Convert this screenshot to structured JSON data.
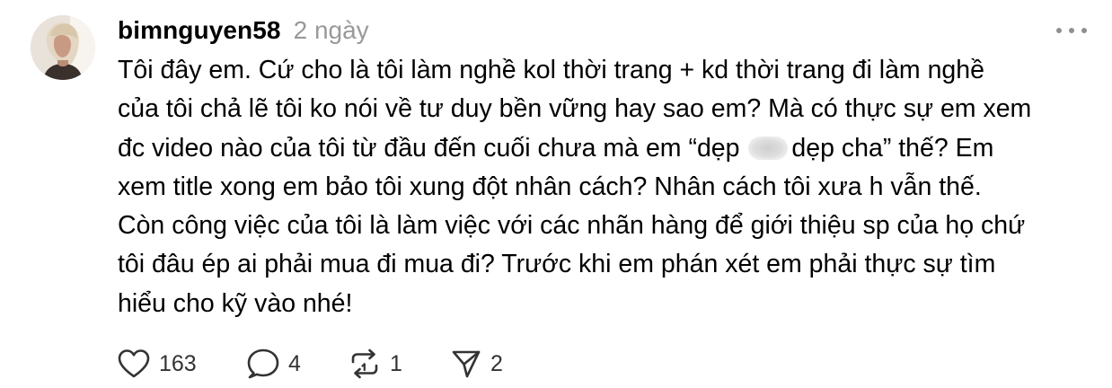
{
  "post": {
    "username": "bimnguyen58",
    "timestamp": "2 ngày",
    "avatar_icon": "user-avatar-photo",
    "more_icon": "more-horizontal-icon",
    "body_lines": [
      "Tôi đây em. Cứ cho là tôi làm nghề kol thời trang + kd thời trang đi làm nghề",
      "của tôi chả lẽ tôi ko nói về tư duy bền vững hay sao em? Mà có thực sự em xem",
      {
        "before": "đc video nào của tôi từ đầu đến cuối chưa mà em “dẹp",
        "after": "dẹp cha” thế? Em"
      },
      "xem title xong em bảo tôi xung đột nhân cách? Nhân cách tôi xưa h vẫn thế.",
      "Còn công việc của tôi là làm việc với các nhãn hàng để giới thiệu sp của họ chứ",
      "tôi đâu ép ai phải mua đi mua đi? Trước khi em phán xét em phải thực sự tìm",
      "hiểu cho kỹ vào nhé!"
    ],
    "actions": {
      "likes": "163",
      "replies": "4",
      "reposts": "1",
      "shares": "2"
    }
  },
  "colors": {
    "text": "#000000",
    "muted": "#999999",
    "icon": "#333333",
    "background": "#ffffff"
  }
}
